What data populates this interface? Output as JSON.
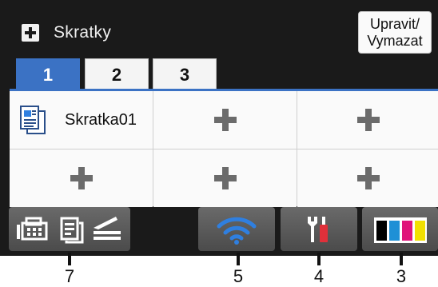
{
  "header": {
    "icon": "plus-icon",
    "title": "Skratky",
    "edit_button": "Upravit/\nVymazat"
  },
  "tabs": [
    {
      "label": "1",
      "active": true
    },
    {
      "label": "2",
      "active": false
    },
    {
      "label": "3",
      "active": false
    }
  ],
  "shortcuts": [
    {
      "label": "Skratka01",
      "icon": "document-icon"
    },
    {
      "label": "",
      "icon": "plus-icon"
    },
    {
      "label": "",
      "icon": "plus-icon"
    },
    {
      "label": "",
      "icon": "plus-icon"
    },
    {
      "label": "",
      "icon": "plus-icon"
    },
    {
      "label": "",
      "icon": "plus-icon"
    }
  ],
  "bottom_bar": [
    {
      "name": "fax-copy-scan",
      "icons": [
        "fax-icon",
        "copy-icon",
        "scan-icon"
      ]
    },
    {
      "name": "wifi",
      "icons": [
        "wifi-icon"
      ]
    },
    {
      "name": "settings",
      "icons": [
        "tools-icon"
      ]
    },
    {
      "name": "toner",
      "icons": [
        "toner-icon"
      ]
    }
  ],
  "callouts": [
    "7",
    "5",
    "4",
    "3"
  ],
  "colors": {
    "screen_bg": "#1a1a1a",
    "tab_active": "#3b72c4",
    "button_bg": "#5a5a5a",
    "wifi_blue": "#2f7fe0",
    "toner_black": "#000000",
    "toner_cyan": "#1e90d6",
    "toner_magenta": "#e0147a",
    "toner_yellow": "#f2e000",
    "tools_red": "#e0303a"
  }
}
